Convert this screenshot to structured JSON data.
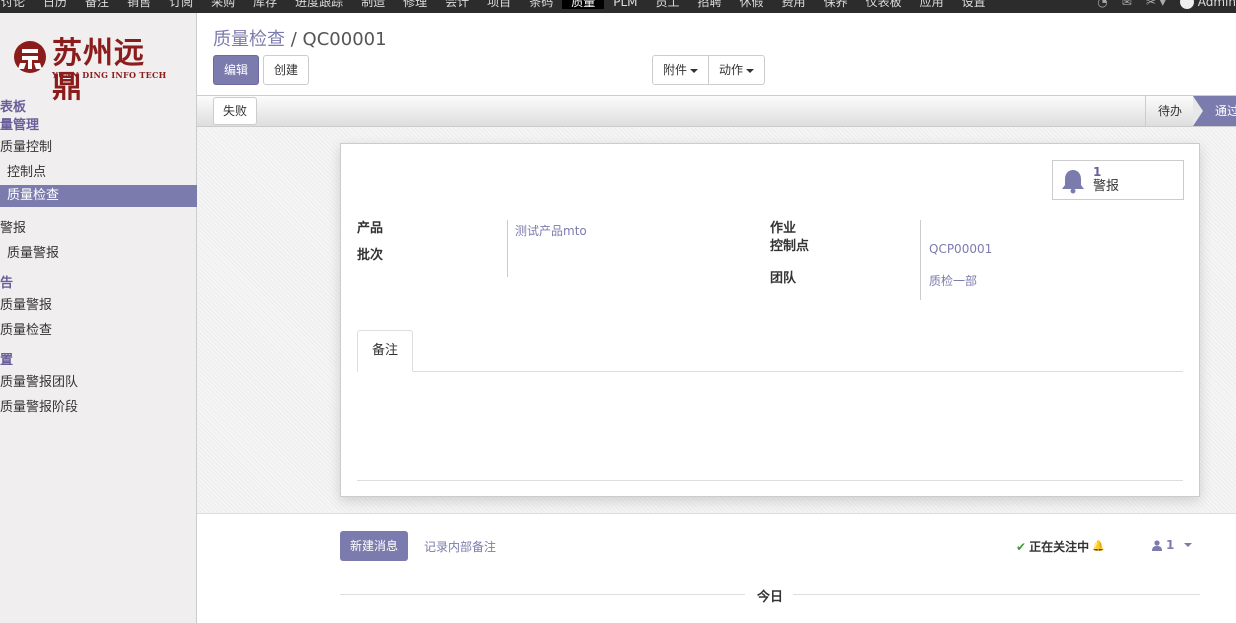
{
  "topnav": {
    "items": [
      "讨论",
      "日历",
      "备注",
      "销售",
      "订阅",
      "采购",
      "库存",
      "进度跟踪",
      "制造",
      "修理",
      "会计",
      "项目",
      "条码",
      "质量",
      "PLM",
      "员工",
      "招聘",
      "休假",
      "费用",
      "保养",
      "仪表板",
      "应用",
      "设置"
    ],
    "active_index": 13,
    "user": "Admin"
  },
  "logo": {
    "cn": "苏州远鼎",
    "en": "YUAN DING INFO TECH"
  },
  "sidebar": {
    "items": [
      {
        "label": "表板",
        "kind": "head"
      },
      {
        "label": "量管理",
        "kind": "head"
      },
      {
        "label": "质量控制",
        "kind": "lvl1"
      },
      {
        "label": "控制点",
        "kind": "lvl2"
      },
      {
        "label": "质量检查",
        "kind": "lvl2 active"
      },
      {
        "label": "警报",
        "kind": "lvl1 section"
      },
      {
        "label": "质量警报",
        "kind": "lvl2"
      },
      {
        "label": "告",
        "kind": "head section"
      },
      {
        "label": "质量警报",
        "kind": "lvl1"
      },
      {
        "label": "质量检查",
        "kind": "lvl1"
      },
      {
        "label": "置",
        "kind": "head section"
      },
      {
        "label": "质量警报团队",
        "kind": "lvl1"
      },
      {
        "label": "质量警报阶段",
        "kind": "lvl1"
      }
    ]
  },
  "breadcrumb": {
    "parent": "质量检查",
    "separator": "/",
    "current": "QC00001"
  },
  "toolbar": {
    "edit": "编辑",
    "create": "创建",
    "attachment": "附件",
    "action": "动作"
  },
  "statusbar": {
    "fail": "失败",
    "todo": "待办",
    "pass": "通过"
  },
  "alert": {
    "count": "1",
    "label": "警报"
  },
  "form": {
    "product_label": "产品",
    "product_value": "测试产品mto",
    "lot_label": "批次",
    "operation_label": "作业",
    "control_point_label": "控制点",
    "control_point_value": "QCP00001",
    "team_label": "团队",
    "team_value": "质检一部"
  },
  "tabs": {
    "notes": "备注"
  },
  "chatter": {
    "new_message": "新建消息",
    "log_note": "记录内部备注",
    "following": "正在关注中",
    "followers": "1",
    "today": "今日"
  },
  "colors": {
    "primary": "#7c7bad",
    "brand_red": "#8a1c1c",
    "topbar": "#2c2c2c"
  }
}
